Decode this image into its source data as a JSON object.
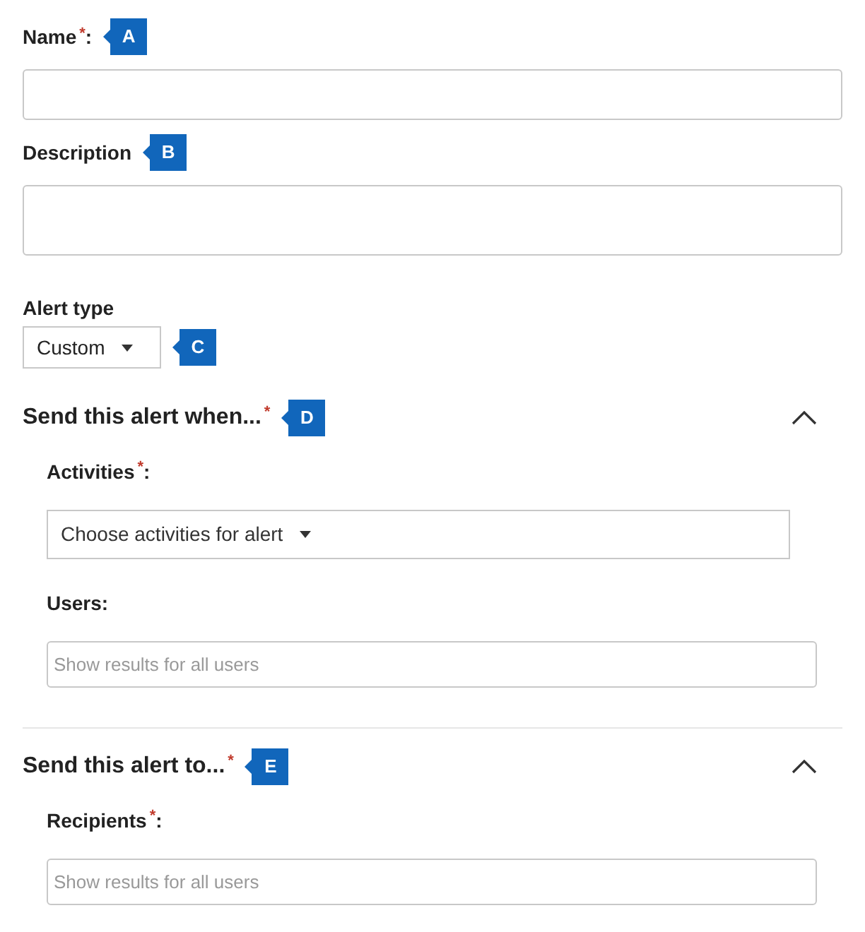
{
  "fields": [
    {
      "kind": "text",
      "label": "Name",
      "asterisk": "*",
      "suffix": ":",
      "callout": "A"
    },
    {
      "kind": "textarea",
      "label": "Description",
      "callout": "B"
    },
    {
      "kind": "dropdown",
      "label": "Alert type",
      "value": "Custom",
      "callout": "C"
    }
  ],
  "sections": [
    {
      "title": "Send this alert when...",
      "asterisk": "*",
      "callout": "D",
      "expanded": true,
      "fields": [
        {
          "kind": "dropdown-wide",
          "label": "Activities",
          "asterisk": "*",
          "suffix": ":",
          "value": "Choose activities for alert"
        },
        {
          "kind": "search",
          "label": "Users",
          "suffix": ":",
          "placeholder": "Show results for all users"
        }
      ]
    },
    {
      "title": "Send this alert to...",
      "asterisk": "*",
      "callout": "E",
      "expanded": true,
      "fields": [
        {
          "kind": "search",
          "label": "Recipients",
          "asterisk": "*",
          "suffix": ":",
          "placeholder": "Show results for all users"
        }
      ]
    }
  ]
}
